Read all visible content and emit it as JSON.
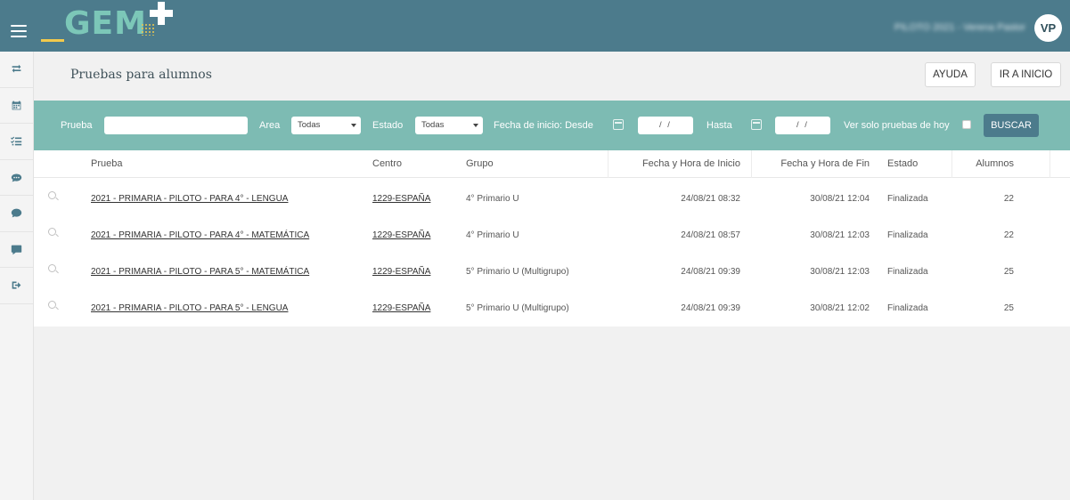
{
  "app": {
    "logo_text": "GEM",
    "user_label": "PILOTO 2021 - Verena Pastor",
    "avatar_initials": "VP"
  },
  "sidebar": {
    "items": [
      {
        "icon": "exchange-icon"
      },
      {
        "icon": "calendar-icon"
      },
      {
        "icon": "checklist-icon"
      },
      {
        "icon": "comments-icon"
      },
      {
        "icon": "comment-icon"
      },
      {
        "icon": "message-icon"
      },
      {
        "icon": "sign-out-icon"
      }
    ]
  },
  "header": {
    "title": "Pruebas para alumnos",
    "help_button": "AYUDA",
    "home_button": "IR A INICIO"
  },
  "filters": {
    "prueba_label": "Prueba",
    "prueba_value": "",
    "area_label": "Area",
    "area_selected": "Todas",
    "estado_label": "Estado",
    "estado_selected": "Todas",
    "fecha_desde_label": "Fecha de inicio: Desde",
    "fecha_desde_value": "/ /",
    "hasta_label": "Hasta",
    "hasta_value": "/ /",
    "solo_hoy_label": "Ver solo pruebas de hoy",
    "search_button": "BUSCAR"
  },
  "table": {
    "columns": [
      "Prueba",
      "Centro",
      "Grupo",
      "Fecha y Hora de Inicio",
      "Fecha y Hora de Fin",
      "Estado",
      "Alumnos"
    ],
    "rows": [
      {
        "prueba": "2021 - PRIMARIA - PILOTO - PARA 4° - LENGUA",
        "centro": "1229-ESPAÑA",
        "grupo": "4° Primario U",
        "inicio": "24/08/21 08:32",
        "fin": "30/08/21 12:04",
        "estado": "Finalizada",
        "alumnos": "22"
      },
      {
        "prueba": "2021 - PRIMARIA - PILOTO - PARA 4° - MATEMÁTICA",
        "centro": "1229-ESPAÑA",
        "grupo": "4° Primario U",
        "inicio": "24/08/21 08:57",
        "fin": "30/08/21 12:03",
        "estado": "Finalizada",
        "alumnos": "22"
      },
      {
        "prueba": "2021 - PRIMARIA - PILOTO - PARA 5° - MATEMÁTICA",
        "centro": "1229-ESPAÑA",
        "grupo": "5° Primario U (Multigrupo)",
        "inicio": "24/08/21 09:39",
        "fin": "30/08/21 12:03",
        "estado": "Finalizada",
        "alumnos": "25"
      },
      {
        "prueba": "2021 - PRIMARIA - PILOTO - PARA 5° - LENGUA",
        "centro": "1229-ESPAÑA",
        "grupo": "5° Primario U (Multigrupo)",
        "inicio": "24/08/21 09:39",
        "fin": "30/08/21 12:02",
        "estado": "Finalizada",
        "alumnos": "25"
      }
    ]
  },
  "colors": {
    "topbar": "#4c7b8c",
    "filter_bar": "#7dbbb3",
    "logo_green": "#7cc7b8",
    "logo_yellow": "#f2c94c"
  }
}
